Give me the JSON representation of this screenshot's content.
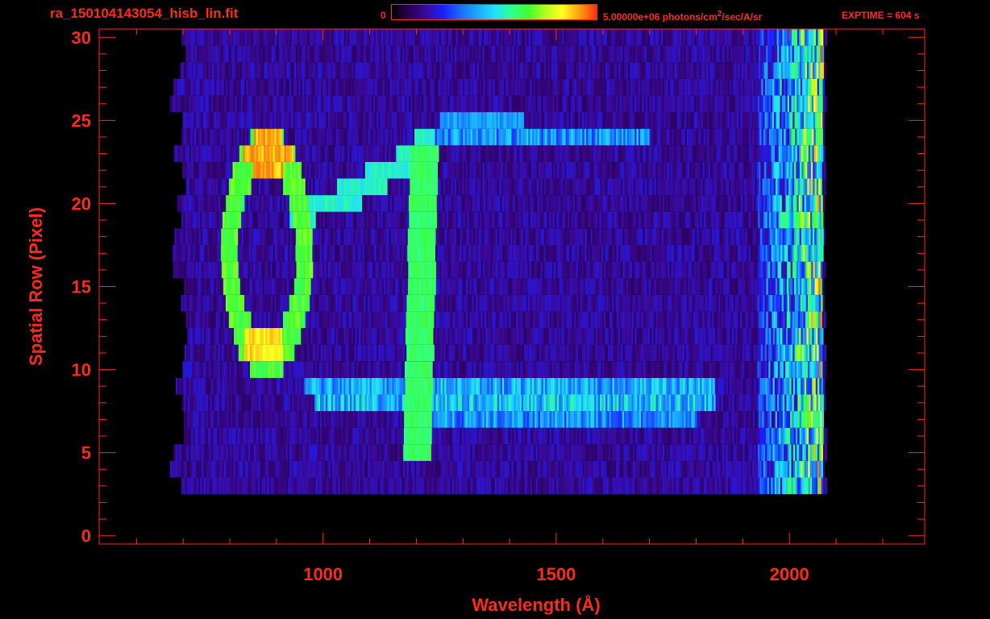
{
  "header": {
    "file_title": "ra_150104143054_hisb_lin.fit",
    "colorbar_min": "0",
    "colorbar_max_prefix": "5.00000e+06 photons/cm",
    "colorbar_max_sup": "2",
    "colorbar_max_suffix": "/sec/A/sr",
    "exptime": "EXPTIME = 604 s"
  },
  "colors": {
    "axis": "#ff2a1a",
    "background": "#000000",
    "colormap": [
      "#000000",
      "#2a0055",
      "#3a0a9a",
      "#1a20ff",
      "#1a6cff",
      "#1aa8ff",
      "#20e0ff",
      "#30ff90",
      "#40ff30",
      "#b0ff20",
      "#ffff20",
      "#ffa010",
      "#ff3010"
    ]
  },
  "chart_data": {
    "type": "heatmap",
    "title": "",
    "xlabel": "Wavelength (Å)",
    "ylabel": "Spatial Row (Pixel)",
    "xlim": [
      520,
      2290
    ],
    "ylim": [
      -0.5,
      30.5
    ],
    "x_ticks": [
      1000,
      1500,
      2000
    ],
    "y_ticks": [
      0,
      5,
      10,
      15,
      20,
      25,
      30
    ],
    "x_tick_labels": [
      "1000",
      "1500",
      "2000"
    ],
    "y_tick_labels": [
      "0",
      "5",
      "10",
      "15",
      "20",
      "25",
      "30"
    ],
    "colorbar_range": [
      0,
      5000000
    ],
    "data_extent": {
      "x": [
        690,
        2070
      ],
      "rows": [
        3,
        30
      ]
    },
    "features": [
      {
        "name": "ring",
        "kind": "ellipse",
        "center": [
          878,
          17
        ],
        "rx": 80,
        "ry": 6.2,
        "intensity": 0.62
      },
      {
        "name": "ring_top_bright",
        "kind": "blob",
        "center": [
          880,
          23
        ],
        "rx": 55,
        "ry": 1.2,
        "intensity": 0.95
      },
      {
        "name": "ring_bottom_bright",
        "kind": "blob",
        "center": [
          870,
          11.5
        ],
        "rx": 45,
        "ry": 1.2,
        "intensity": 0.9
      },
      {
        "name": "arc_to_vertical",
        "kind": "path",
        "points": [
          [
            950,
            19.5
          ],
          [
            1060,
            20.5
          ],
          [
            1110,
            21.5
          ],
          [
            1180,
            22.5
          ],
          [
            1215,
            23.5
          ]
        ],
        "intensity": 0.5
      },
      {
        "name": "vertical_line",
        "kind": "path",
        "points": [
          [
            1215,
            23
          ],
          [
            1208,
            14
          ],
          [
            1200,
            5
          ]
        ],
        "intensity": 0.58
      },
      {
        "name": "upper_band",
        "kind": "band",
        "x": [
          1195,
          1700
        ],
        "row": 24,
        "intensity": 0.38
      },
      {
        "name": "upper_knot",
        "kind": "blob",
        "center": [
          1340,
          25
        ],
        "rx": 90,
        "ry": 0.8,
        "intensity": 0.45
      },
      {
        "name": "lower_band_1",
        "kind": "band",
        "x": [
          960,
          1840
        ],
        "row": 9,
        "intensity": 0.42
      },
      {
        "name": "lower_band_2",
        "kind": "band",
        "x": [
          980,
          1840
        ],
        "row": 8,
        "intensity": 0.45
      },
      {
        "name": "lower_band_3",
        "kind": "band",
        "x": [
          1200,
          1800
        ],
        "row": 7,
        "intensity": 0.38
      },
      {
        "name": "edge_noise",
        "kind": "band",
        "x": [
          1930,
          2070
        ],
        "row": "all",
        "intensity": 0.45
      }
    ]
  }
}
